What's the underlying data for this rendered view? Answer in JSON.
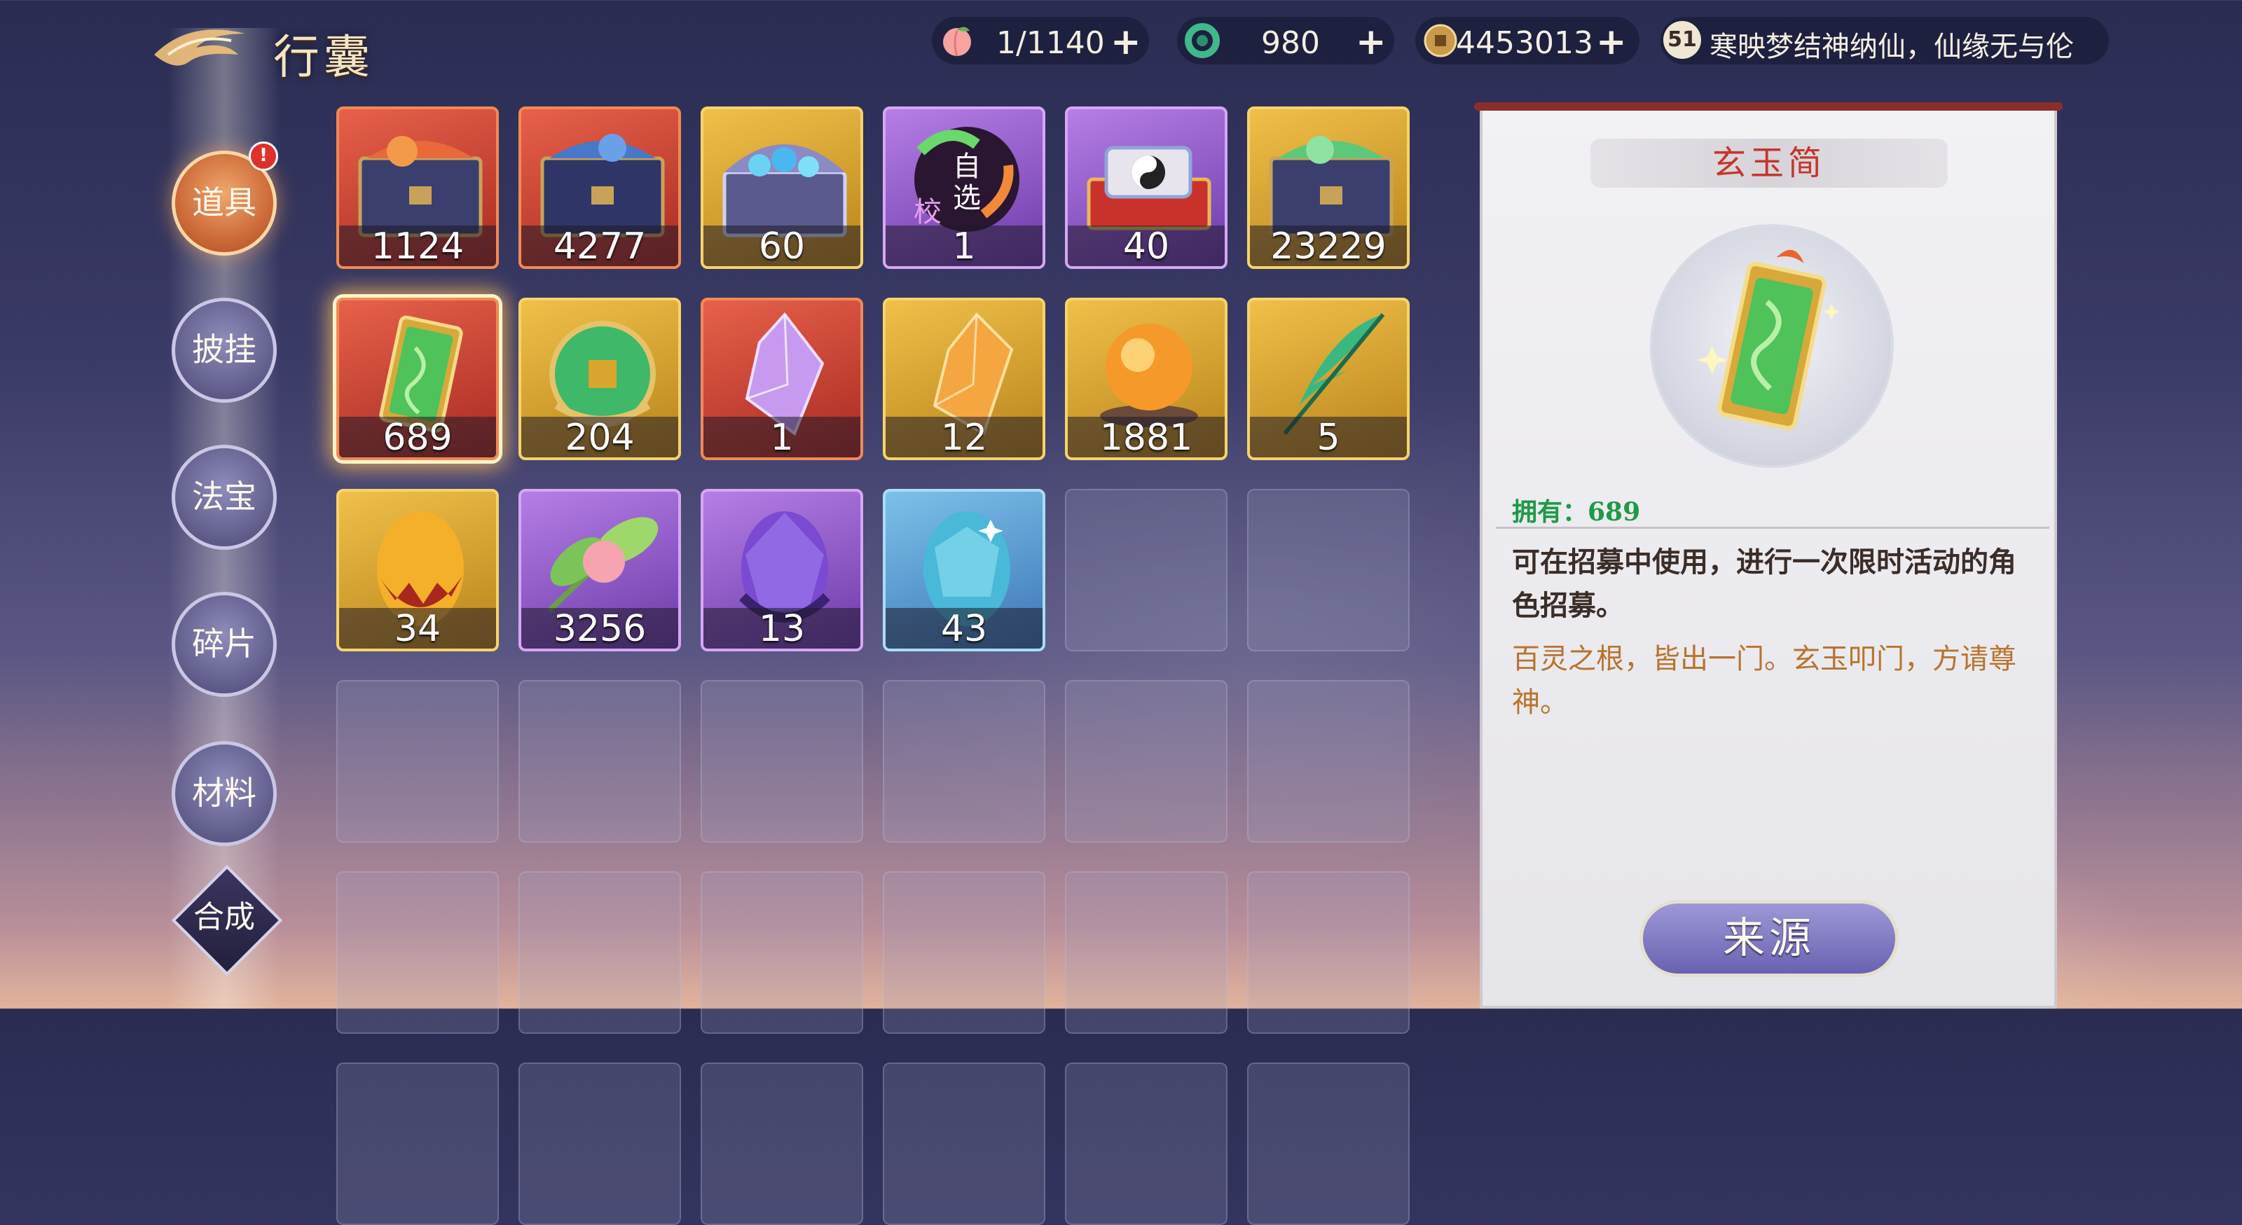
{
  "header": {
    "title": "行囊",
    "resources": [
      {
        "icon": "peach-icon",
        "value": "1/1140",
        "plus": "+"
      },
      {
        "icon": "jade-ring-icon",
        "value": "980",
        "plus": "+"
      },
      {
        "icon": "coin-icon",
        "value": "4453013",
        "plus": "+"
      }
    ],
    "player": {
      "level": "51",
      "name": "寒映梦结神纳仙，仙缘无与伦"
    }
  },
  "nav": {
    "items": [
      {
        "label": "道具",
        "active": true
      },
      {
        "label": "披挂"
      },
      {
        "label": "法宝"
      },
      {
        "label": "碎片"
      },
      {
        "label": "材料"
      },
      {
        "label": "合成"
      }
    ],
    "badge": "!"
  },
  "inventory": {
    "items": [
      {
        "icon": "red-treasure-chest-icon",
        "rarity": "red",
        "qty": "1124"
      },
      {
        "icon": "blue-treasure-chest-icon",
        "rarity": "red",
        "qty": "4277"
      },
      {
        "icon": "pearl-chest-icon",
        "rarity": "gold",
        "qty": "60"
      },
      {
        "icon": "self-select-token-icon",
        "rarity": "purple",
        "qty": "1",
        "overlay": "自选",
        "tag": "校"
      },
      {
        "icon": "taiji-box-icon",
        "rarity": "purple",
        "qty": "40"
      },
      {
        "icon": "green-treasure-chest-icon",
        "rarity": "gold",
        "qty": "23229"
      },
      {
        "icon": "jade-slip-icon",
        "rarity": "red",
        "qty": "689",
        "selected": true
      },
      {
        "icon": "jade-coin-icon",
        "rarity": "gold",
        "qty": "204"
      },
      {
        "icon": "purple-crystal-icon",
        "rarity": "red",
        "qty": "1"
      },
      {
        "icon": "orange-crystal-icon",
        "rarity": "gold",
        "qty": "12"
      },
      {
        "icon": "fire-orb-icon",
        "rarity": "gold",
        "qty": "1881"
      },
      {
        "icon": "green-feather-icon",
        "rarity": "gold",
        "qty": "5"
      },
      {
        "icon": "fire-egg-icon",
        "rarity": "gold",
        "qty": "34"
      },
      {
        "icon": "peach-blossom-icon",
        "rarity": "purple",
        "qty": "3256"
      },
      {
        "icon": "purple-egg-icon",
        "rarity": "purple",
        "qty": "13"
      },
      {
        "icon": "blue-egg-icon",
        "rarity": "blue",
        "qty": "43"
      }
    ],
    "total_slots": 36
  },
  "detail": {
    "name": "玄玉简",
    "owned_label": "拥有：689",
    "description": "可在招募中使用，进行一次限时活动的角色招募。",
    "lore": "百灵之根，皆出一门。玄玉叩门，方请尊神。",
    "source_button": "来源"
  },
  "colors": {
    "red": "#c8402f",
    "gold": "#d9a52e",
    "purple": "#9a62d2",
    "blue": "#5e9fd6",
    "owned_text": "#1e9a48",
    "lore_text": "#b8742e",
    "title_text": "#c4372c"
  }
}
